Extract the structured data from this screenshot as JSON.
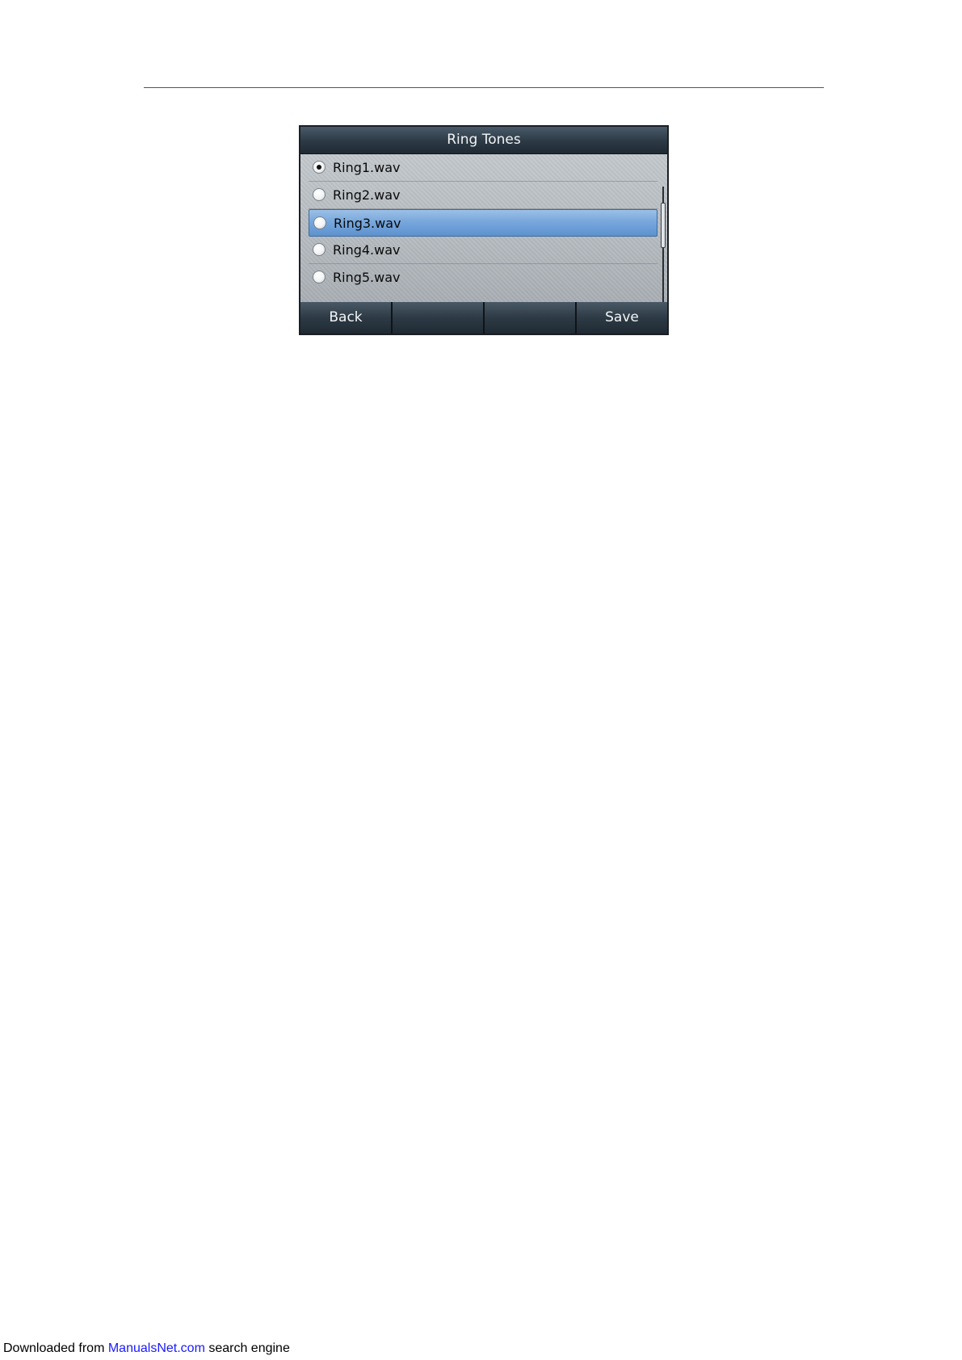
{
  "screen": {
    "title": "Ring Tones",
    "items": [
      {
        "label": "Ring1.wav",
        "checked": true,
        "highlighted": false
      },
      {
        "label": "Ring2.wav",
        "checked": false,
        "highlighted": false
      },
      {
        "label": "Ring3.wav",
        "checked": false,
        "highlighted": true
      },
      {
        "label": "Ring4.wav",
        "checked": false,
        "highlighted": false
      },
      {
        "label": "Ring5.wav",
        "checked": false,
        "highlighted": false
      }
    ],
    "softkeys": [
      "Back",
      "",
      "",
      "Save"
    ]
  },
  "footer": {
    "prefix": "Downloaded from ",
    "link": "ManualsNet.com",
    "suffix": " search engine"
  },
  "colors": {
    "highlight": "#78a7dc",
    "title_bar": "#2c3945",
    "link": "#1a1aff"
  }
}
